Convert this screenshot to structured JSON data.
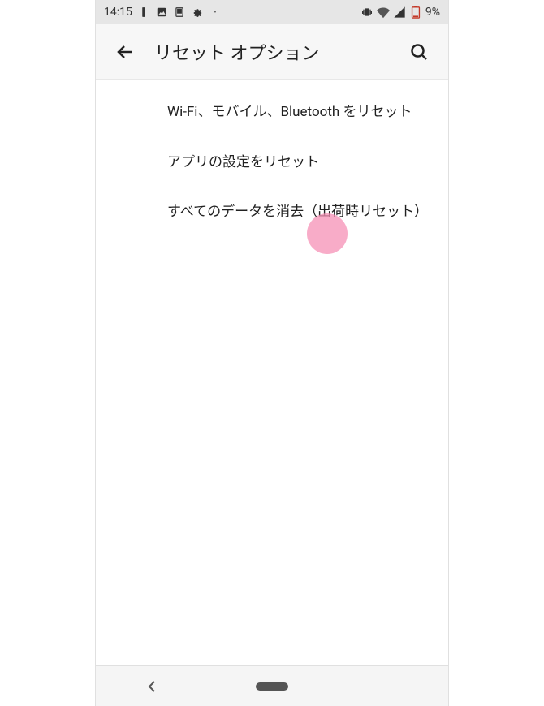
{
  "status_bar": {
    "time": "14:15",
    "battery_percent": "9%"
  },
  "app_bar": {
    "title": "リセット オプション"
  },
  "options": [
    {
      "label": "Wi-Fi、モバイル、Bluetooth をリセット"
    },
    {
      "label": "アプリの設定をリセット"
    },
    {
      "label": "すべてのデータを消去（出荷時リセット）"
    }
  ]
}
